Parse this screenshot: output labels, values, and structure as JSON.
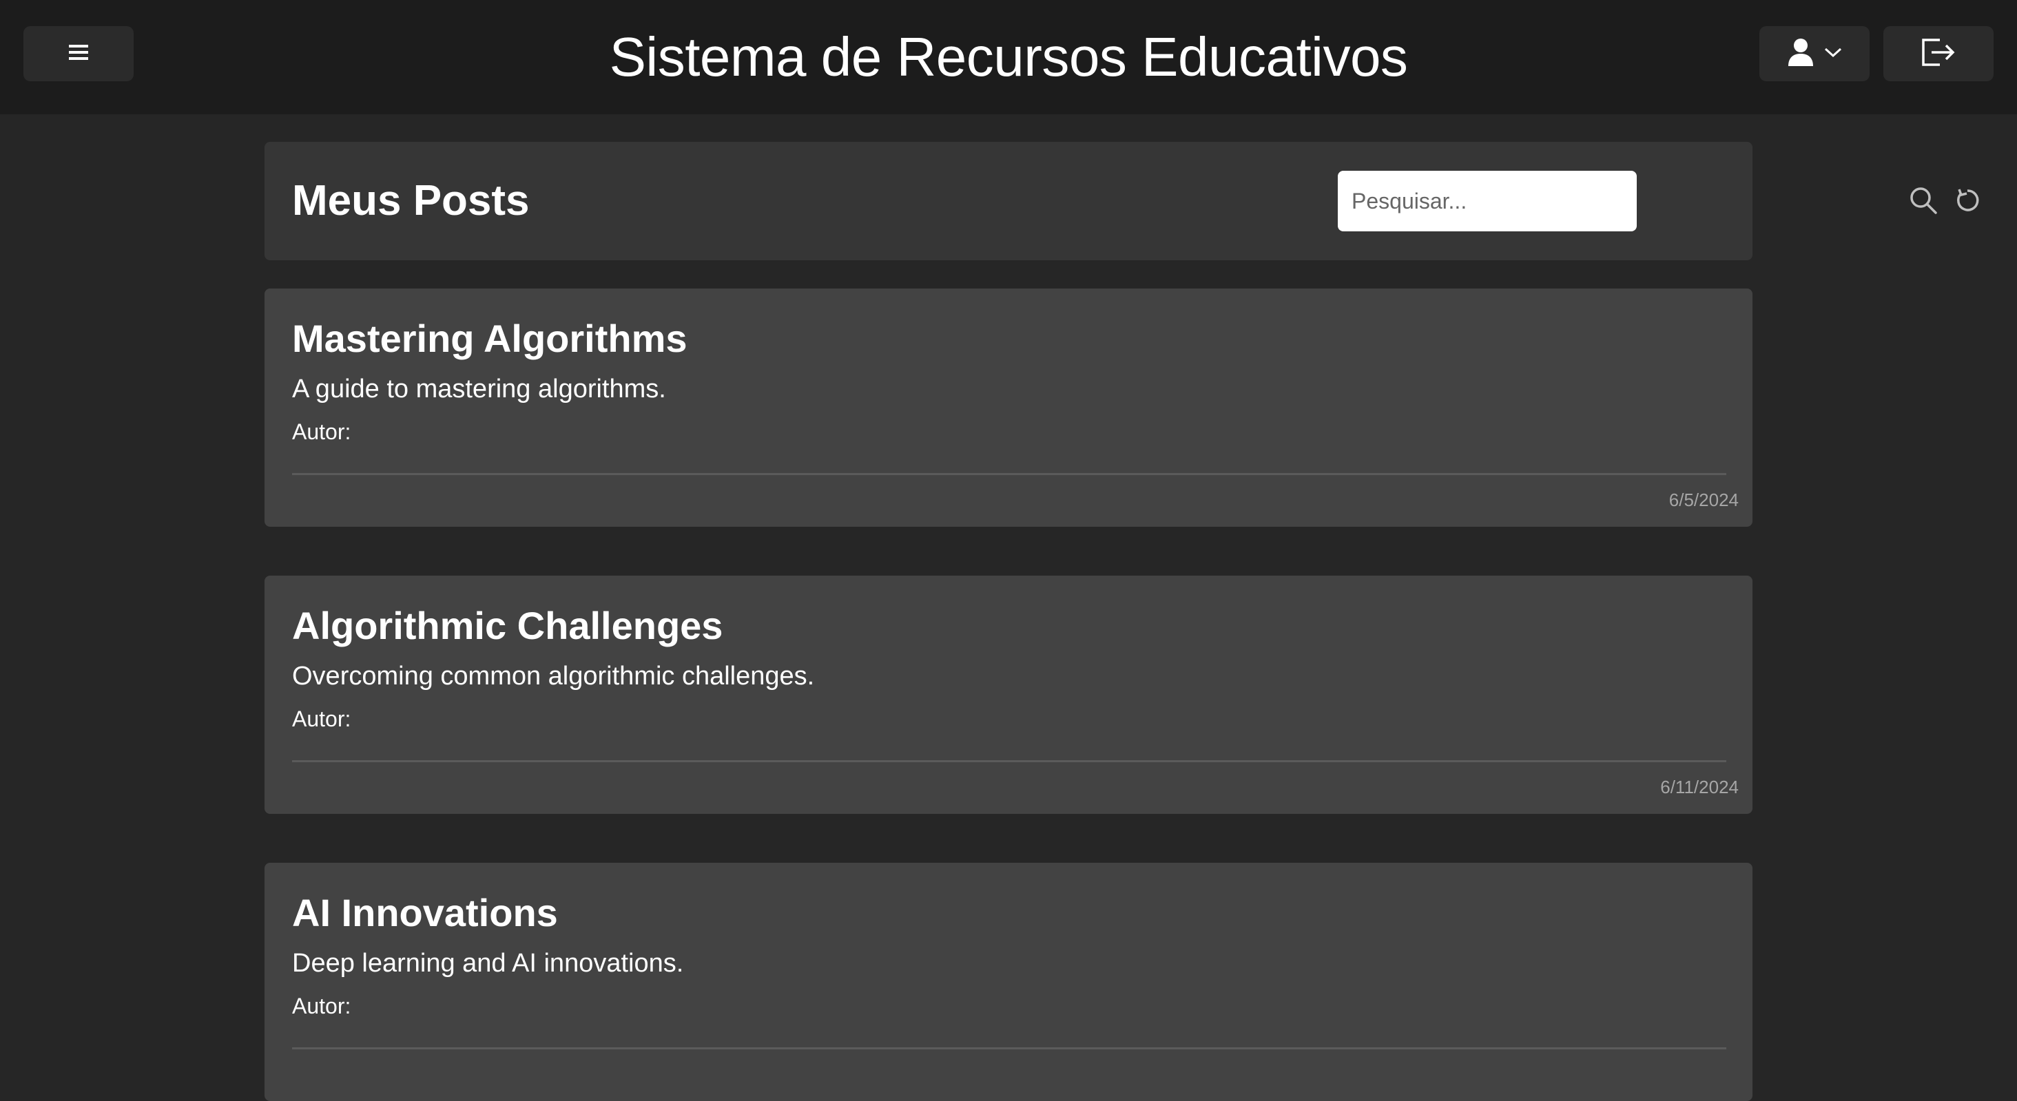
{
  "header": {
    "title": "Sistema de Recursos Educativos"
  },
  "toolbar": {
    "menu_icon": "hamburger-menu-icon",
    "user_icon": "user-icon",
    "user_dropdown_icon": "chevron-down-icon",
    "logout_icon": "logout-icon"
  },
  "page": {
    "title": "Meus Posts",
    "search": {
      "placeholder": "Pesquisar...",
      "value": ""
    },
    "search_icon": "search-icon",
    "refresh_icon": "refresh-icon"
  },
  "posts": [
    {
      "title": "Mastering Algorithms",
      "description": "A guide to mastering algorithms.",
      "author_label": "Autor:",
      "date": "6/5/2024"
    },
    {
      "title": "Algorithmic Challenges",
      "description": "Overcoming common algorithmic challenges.",
      "author_label": "Autor:",
      "date": "6/11/2024"
    },
    {
      "title": "AI Innovations",
      "description": "Deep learning and AI innovations.",
      "author_label": "Autor:",
      "date": ""
    }
  ],
  "colors": {
    "background": "#262626",
    "topbar": "#1c1c1c",
    "header_card": "#363636",
    "post_card": "#434343",
    "text": "#ffffff",
    "muted_text": "#a6a6a6"
  }
}
